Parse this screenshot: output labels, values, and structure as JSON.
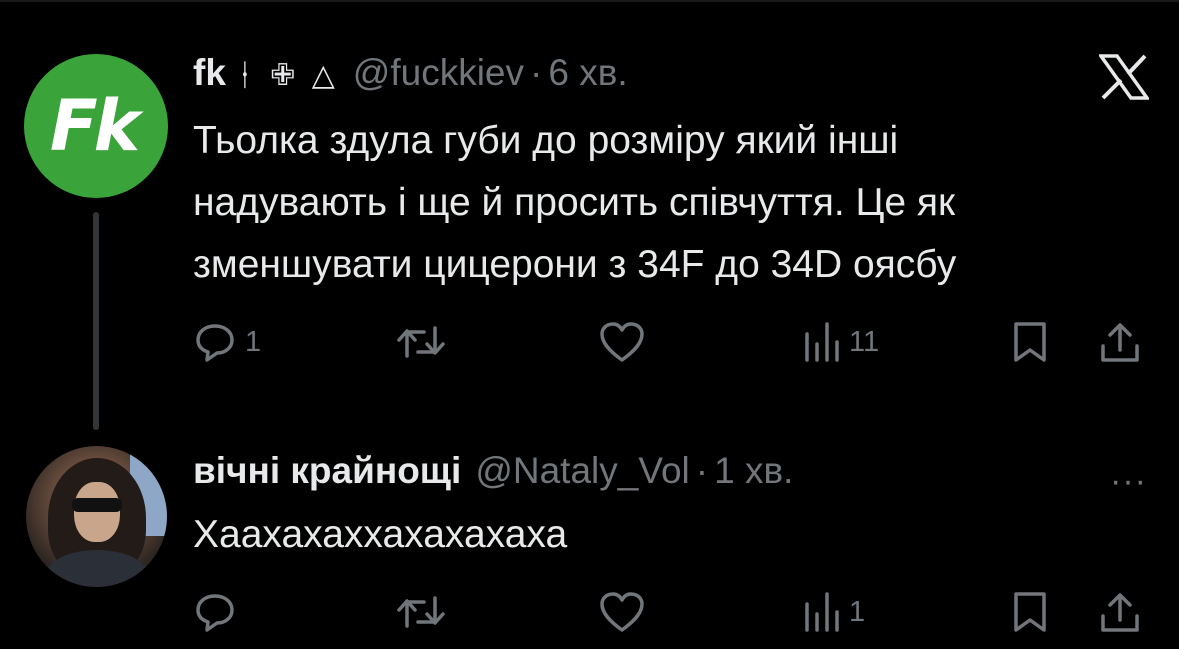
{
  "tweets": [
    {
      "name": "fk",
      "name_symbols": "ᚽ ✙ △",
      "handle": "@fuckkiev",
      "separator": "·",
      "time": "6 хв.",
      "avatar_text": "Fk",
      "avatar_color": "#3aa33a",
      "text_lines": [
        "Тьолка здула губи до розміру який інші",
        "надувають і ще й просить співчуття. Це як",
        "зменшувати цицерони з 34F до 34D оясбу"
      ],
      "replies": "1",
      "retweets": "",
      "likes": "",
      "views": "11",
      "corner_icon": "x-logo-icon"
    },
    {
      "name": "вічні крайнощі",
      "handle": "@Nataly_Vol",
      "separator": "·",
      "time": "1 хв.",
      "text_lines": [
        "Хаахахаххахахахаха"
      ],
      "replies": "",
      "retweets": "",
      "likes": "",
      "views": "1",
      "corner_icon": "more-icon",
      "corner_text": "···"
    }
  ],
  "colors": {
    "background": "#000000",
    "text": "#e7e9ea",
    "secondary": "#71767b",
    "thread_line": "#333639"
  }
}
